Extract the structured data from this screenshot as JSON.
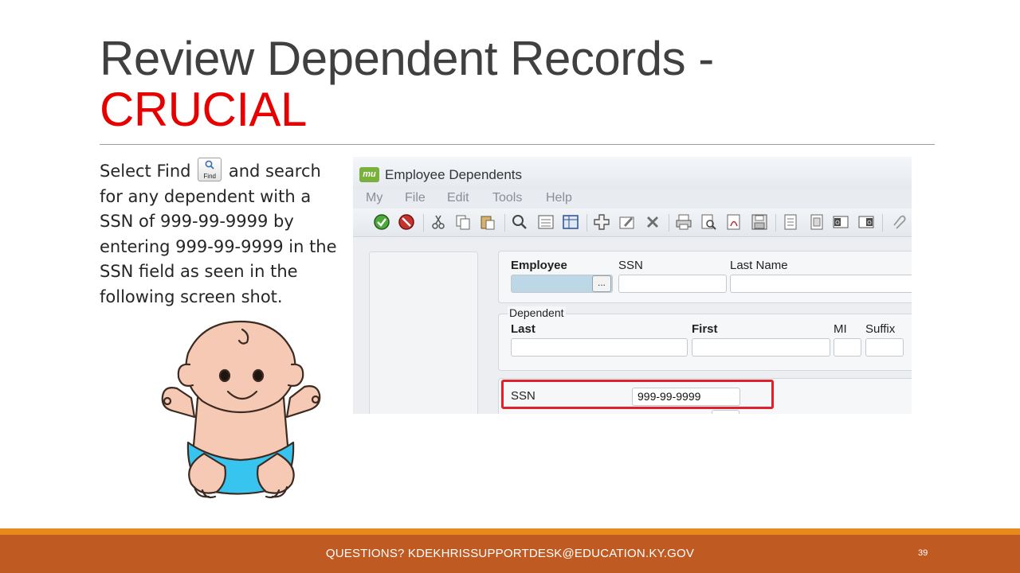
{
  "slide": {
    "title_main": "Review Dependent Records -",
    "title_accent": "CRUCIAL",
    "body_before": "Select Find",
    "find_icon_label": "Find",
    "body_after": " and search for any dependent with a SSN of 999-99-9999 by entering 999-99-9999 in the SSN field as seen in the following screen shot.",
    "footer": "QUESTIONS?  KDEKHRISSUPPORTDESK@EDUCATION.KY.GOV",
    "page_number": "39"
  },
  "app": {
    "logo": "mu",
    "window_title": "Employee Dependents",
    "menu": [
      "My",
      "File",
      "Edit",
      "Tools",
      "Help"
    ],
    "toolbar_icons": [
      "accept-icon",
      "cancel-icon",
      "cut-icon",
      "copy-icon",
      "paste-icon",
      "find-icon",
      "browse-icon",
      "grid-icon",
      "add-icon",
      "edit-icon",
      "delete-icon",
      "print-icon",
      "print-preview-icon",
      "pdf-icon",
      "save-icon",
      "export-icon",
      "import-icon",
      "outlook-icon",
      "outlook-alt-icon",
      "attach-icon"
    ],
    "employee_group": {
      "employee_label": "Employee",
      "ellipsis": "...",
      "ssn_label": "SSN",
      "last_name_label": "Last Name"
    },
    "dependent_group": {
      "title": "Dependent",
      "last_label": "Last",
      "first_label": "First",
      "mi_label": "MI",
      "suffix_label": "Suffix"
    },
    "ssn_search": {
      "label": "SSN",
      "value": "999-99-9999"
    },
    "highlight_color": "#e0202a"
  },
  "colors": {
    "title_text": "#404040",
    "accent": "#e60000",
    "footer_band": "#c05a23",
    "footer_stripe": "#e8891c"
  }
}
